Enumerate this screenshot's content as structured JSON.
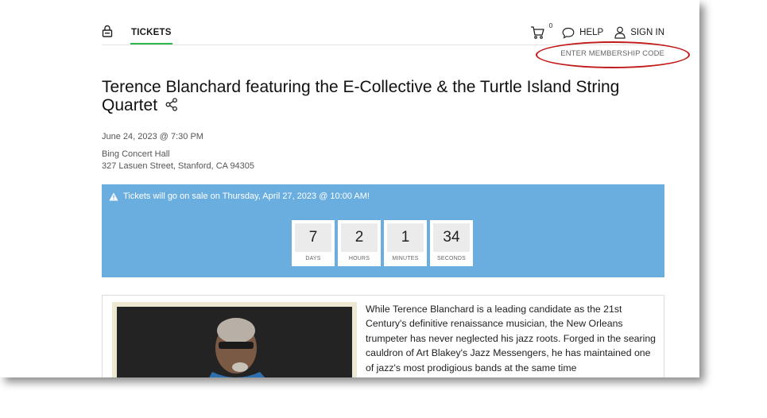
{
  "nav": {
    "tickets_label": "TICKETS",
    "cart_count": "0",
    "help_label": "HELP",
    "signin_label": "SIGN IN",
    "membership_label": "ENTER MEMBERSHIP CODE"
  },
  "event": {
    "title": "Terence Blanchard featuring the E-Collective & the Turtle Island String Quartet",
    "date": "June 24, 2023 @ 7:30 PM",
    "venue": "Bing Concert Hall",
    "address": "327 Lasuen Street, Stanford, CA 94305"
  },
  "sale": {
    "notice": "Tickets will go on sale on Thursday, April 27, 2023 @ 10:00 AM!",
    "countdown": [
      {
        "value": "7",
        "label": "DAYS"
      },
      {
        "value": "2",
        "label": "HOURS"
      },
      {
        "value": "1",
        "label": "MINUTES"
      },
      {
        "value": "34",
        "label": "SECONDS"
      }
    ]
  },
  "description": "While Terence Blanchard is a leading candidate as the 21st Century's definitive renaissance musician, the New Orleans trumpeter has never neglected his jazz roots. Forged in the searing cauldron of Art Blakey's Jazz Messengers, he has maintained one of jazz's most prodigious bands at the same time",
  "colors": {
    "accent_green": "#2eb84b",
    "banner_blue": "#6aaee0",
    "annotation_red": "#c21a1a"
  },
  "icons": [
    "lock-icon",
    "cart-icon",
    "chat-bubble-icon",
    "user-icon",
    "share-icon",
    "warning-icon"
  ]
}
